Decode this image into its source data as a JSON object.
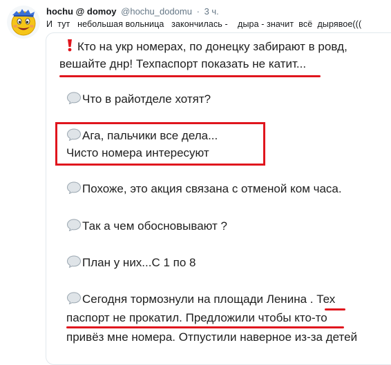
{
  "tweet": {
    "author_name": "hochu @ domoy",
    "author_handle": "@hochu_dodomu",
    "separator": "·",
    "time": "3 ч.",
    "text": "И  тут   небольшая вольница   закончилась -    дыра - значит  всё  дырявое((("
  },
  "screenshot": {
    "messages": [
      {
        "icon": "exclamation-icon",
        "lines": [
          "Кто на укр номерах, по донецку забирают в ровд,",
          "вешайте днр! Техпаспорт показать не катит..."
        ]
      },
      {
        "icon": "speech-bubble-icon",
        "lines": [
          "Что в райотделе хотят?"
        ]
      },
      {
        "icon": "speech-bubble-icon",
        "lines": [
          "Ага, пальчики все дела...",
          "Чисто номера интересуют"
        ]
      },
      {
        "icon": "speech-bubble-icon",
        "lines": [
          "Похоже, это акция связана с отменой ком часа."
        ]
      },
      {
        "icon": "speech-bubble-icon",
        "lines": [
          "Так а чем обосновывают ?"
        ]
      },
      {
        "icon": "speech-bubble-icon",
        "lines": [
          "План у них...С 1 по 8"
        ]
      },
      {
        "icon": "speech-bubble-icon",
        "lines": [
          "Сегодня тормознули на площади Ленина . Тех",
          "паспорт не прокатил. Предложили чтобы кто-то",
          "привёз мне номера. Отпустили наверное из-за детей"
        ]
      }
    ],
    "highlight_color": "#e0151d"
  }
}
